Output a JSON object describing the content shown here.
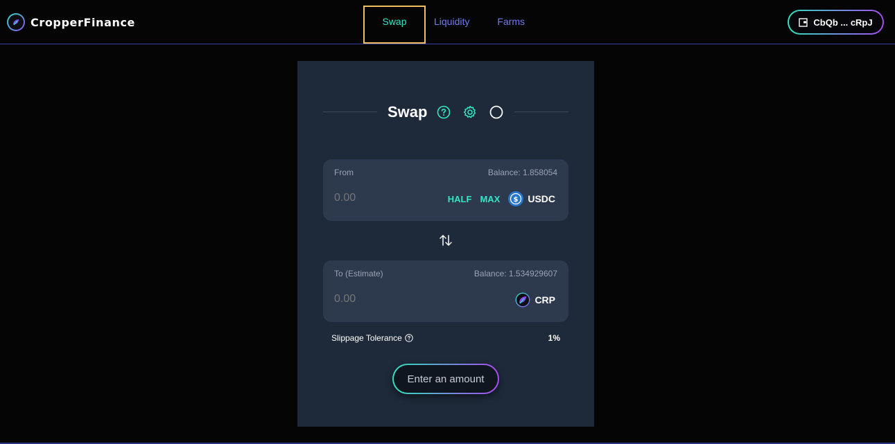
{
  "brand": {
    "name": "CropperFinance"
  },
  "nav": {
    "swap": "Swap",
    "liquidity": "Liquidity",
    "farms": "Farms"
  },
  "wallet": {
    "label": "CbQb ... cRpJ"
  },
  "swap": {
    "title": "Swap",
    "from": {
      "label": "From",
      "balance": "Balance: 1.858054",
      "placeholder": "0.00",
      "half": "HALF",
      "max": "MAX",
      "token": "USDC"
    },
    "to": {
      "label": "To (Estimate)",
      "balance": "Balance: 1.534929607",
      "placeholder": "0.00",
      "token": "CRP"
    },
    "slippage": {
      "label": "Slippage Tolerance",
      "value": "1%"
    },
    "action": "Enter an amount"
  },
  "colors": {
    "background": "#050505",
    "panel": "#1e2a3a",
    "input_box": "#2d3a4e",
    "accent_teal": "#33e6c4",
    "accent_purple": "#a54bf0",
    "nav_link": "#6f7bf0",
    "active_outline": "#f0c060"
  },
  "icons": {
    "brand": "cropper-logo-icon",
    "wallet": "wallet-icon",
    "help": "help-circle-icon",
    "settings": "gear-icon",
    "refresh": "refresh-circle-icon",
    "usdc": "usdc-token-icon",
    "crp": "crp-token-icon",
    "switch": "swap-arrows-icon"
  }
}
